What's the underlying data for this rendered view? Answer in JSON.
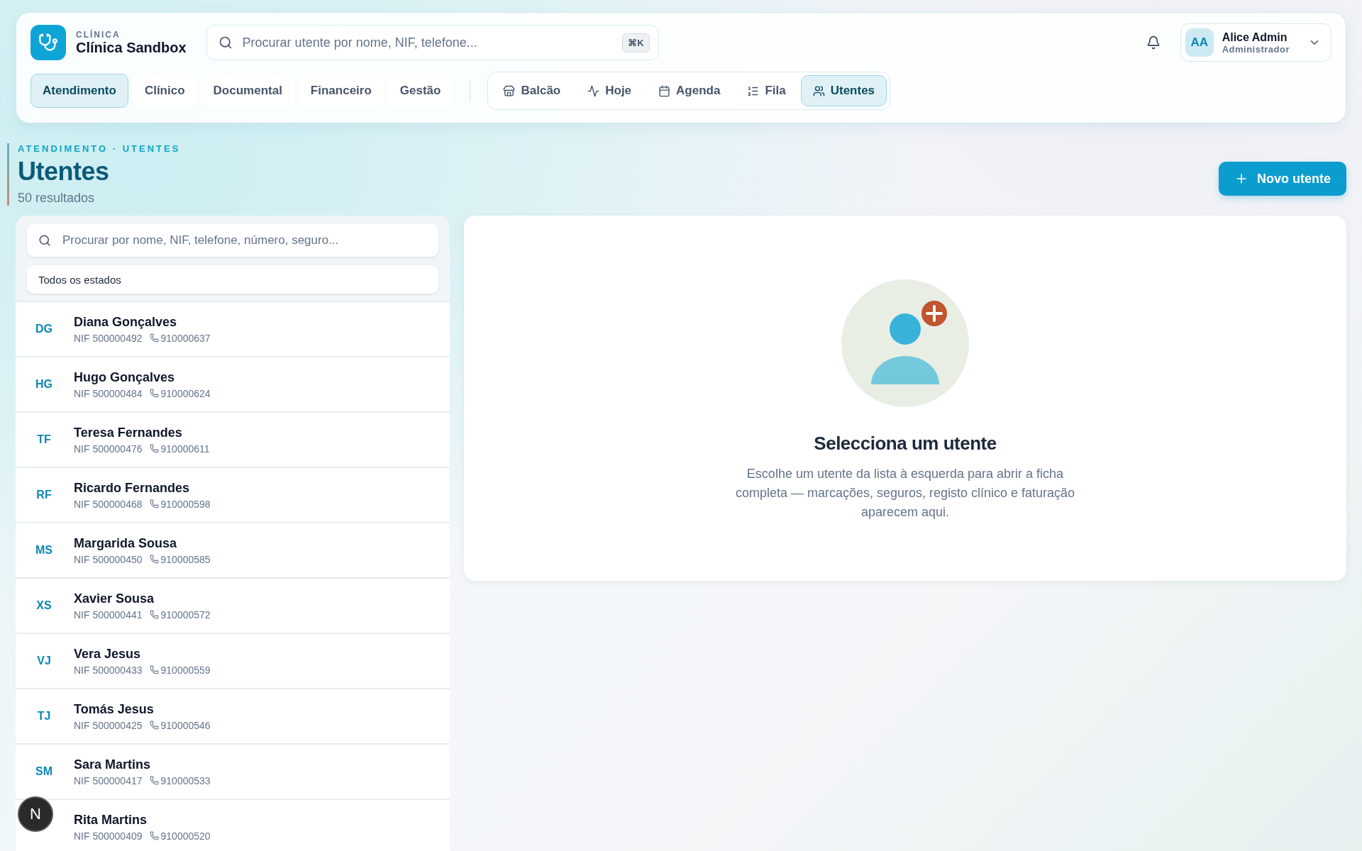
{
  "brand": {
    "eyebrow": "CLÍNICA",
    "name": "Clínica Sandbox"
  },
  "search": {
    "placeholder": "Procurar utente por nome, NIF, telefone...",
    "shortcut": "⌘K"
  },
  "user": {
    "initials": "AA",
    "name": "Alice Admin",
    "role": "Administrador"
  },
  "sections": [
    {
      "label": "Atendimento",
      "selected": true
    },
    {
      "label": "Clínico",
      "selected": false
    },
    {
      "label": "Documental",
      "selected": false
    },
    {
      "label": "Financeiro",
      "selected": false
    },
    {
      "label": "Gestão",
      "selected": false
    }
  ],
  "subnav": [
    {
      "label": "Balcão",
      "selected": false
    },
    {
      "label": "Hoje",
      "selected": false
    },
    {
      "label": "Agenda",
      "selected": false
    },
    {
      "label": "Fila",
      "selected": false
    },
    {
      "label": "Utentes",
      "selected": true
    }
  ],
  "page": {
    "breadcrumb": "ATENDIMENTO · UTENTES",
    "title": "Utentes",
    "subtitle": "50 resultados",
    "new_button": "Novo utente"
  },
  "list": {
    "search_placeholder": "Procurar por nome, NIF, telefone, número, seguro...",
    "filter": "Todos os estados",
    "rows": [
      {
        "initials": "DG",
        "name": "Diana Gonçalves",
        "nif": "NIF 500000492",
        "phone": "910000637"
      },
      {
        "initials": "HG",
        "name": "Hugo Gonçalves",
        "nif": "NIF 500000484",
        "phone": "910000624"
      },
      {
        "initials": "TF",
        "name": "Teresa Fernandes",
        "nif": "NIF 500000476",
        "phone": "910000611"
      },
      {
        "initials": "RF",
        "name": "Ricardo Fernandes",
        "nif": "NIF 500000468",
        "phone": "910000598"
      },
      {
        "initials": "MS",
        "name": "Margarida Sousa",
        "nif": "NIF 500000450",
        "phone": "910000585"
      },
      {
        "initials": "XS",
        "name": "Xavier Sousa",
        "nif": "NIF 500000441",
        "phone": "910000572"
      },
      {
        "initials": "VJ",
        "name": "Vera Jesus",
        "nif": "NIF 500000433",
        "phone": "910000559"
      },
      {
        "initials": "TJ",
        "name": "Tomás Jesus",
        "nif": "NIF 500000425",
        "phone": "910000546"
      },
      {
        "initials": "SM",
        "name": "Sara Martins",
        "nif": "NIF 500000417",
        "phone": "910000533"
      },
      {
        "name": "Rita Martins",
        "nif": "NIF 500000409",
        "phone": "910000520"
      }
    ]
  },
  "empty_state": {
    "title": "Selecciona um utente",
    "text": "Escolhe um utente da lista à esquerda para abrir a ficha completa — marcações, seguros, registo clínico e faturação aparecem aqui."
  },
  "dev_badge": "N"
}
